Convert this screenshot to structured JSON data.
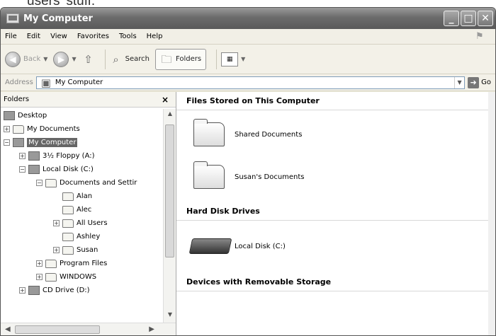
{
  "caption": "users' stuff.",
  "window": {
    "title": "My Computer",
    "buttons": {
      "minimize": "_",
      "maximize": "□",
      "close": "✕"
    }
  },
  "menu": [
    "File",
    "Edit",
    "View",
    "Favorites",
    "Tools",
    "Help"
  ],
  "toolbar": {
    "back": "Back",
    "search": "Search",
    "folders": "Folders"
  },
  "address": {
    "label": "Address",
    "value": "My Computer",
    "go": "Go"
  },
  "folders_pane": {
    "title": "Folders",
    "close": "×",
    "tree": [
      {
        "label": "Desktop",
        "exp": ""
      },
      {
        "label": "My Documents",
        "exp": "+"
      },
      {
        "label": "My Computer",
        "exp": "−",
        "selected": true
      },
      {
        "label": "3½ Floppy (A:)",
        "exp": "+"
      },
      {
        "label": "Local Disk (C:)",
        "exp": "−"
      },
      {
        "label": "Documents and Settir",
        "exp": "−"
      },
      {
        "label": "Alan",
        "exp": ""
      },
      {
        "label": "Alec",
        "exp": ""
      },
      {
        "label": "All Users",
        "exp": "+"
      },
      {
        "label": "Ashley",
        "exp": ""
      },
      {
        "label": "Susan",
        "exp": "+"
      },
      {
        "label": "Program Files",
        "exp": "+"
      },
      {
        "label": "WINDOWS",
        "exp": "+"
      },
      {
        "label": "CD Drive (D:)",
        "exp": "+"
      }
    ]
  },
  "files": {
    "sections": [
      {
        "title": "Files Stored on This Computer",
        "items": [
          "Shared Documents",
          "Susan's Documents"
        ]
      },
      {
        "title": "Hard Disk Drives",
        "items": [
          "Local Disk (C:)"
        ]
      },
      {
        "title": "Devices with Removable Storage",
        "items": []
      }
    ]
  }
}
